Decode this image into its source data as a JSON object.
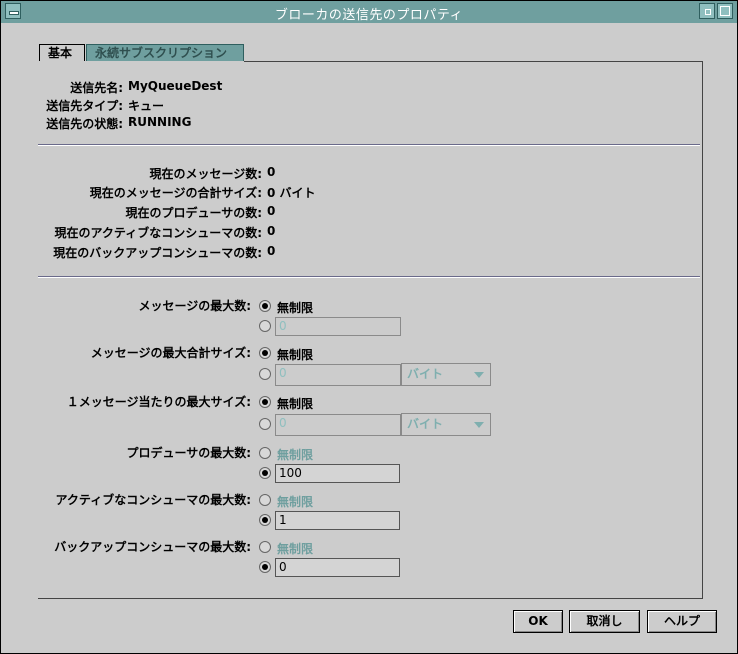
{
  "window": {
    "title": "ブローカの送信先のプロパティ"
  },
  "tabs": [
    {
      "label": "基本",
      "active": true
    },
    {
      "label": "永続サブスクリプション",
      "active": false
    }
  ],
  "info": {
    "name_label": "送信先名:",
    "name_value": "MyQueueDest",
    "type_label": "送信先タイプ:",
    "type_value": "キュー",
    "state_label": "送信先の状態:",
    "state_value": "RUNNING"
  },
  "stats": {
    "cur_msgs_label": "現在のメッセージ数:",
    "cur_msgs_value": "0",
    "cur_total_label": "現在のメッセージの合計サイズ:",
    "cur_total_value": "0 バイト",
    "cur_producers_label": "現在のプロデューサの数:",
    "cur_producers_value": "0",
    "cur_active_label": "現在のアクティブなコンシューマの数:",
    "cur_active_value": "0",
    "cur_backup_label": "現在のバックアップコンシューマの数:",
    "cur_backup_value": "0"
  },
  "limits": {
    "unlimited": "無制限",
    "max_msgs_label": "メッセージの最大数:",
    "max_msgs_value": "0",
    "max_total_label": "メッセージの最大合計サイズ:",
    "max_total_value": "0",
    "max_total_unit": "バイト",
    "max_per_label": "１メッセージ当たりの最大サイズ:",
    "max_per_value": "0",
    "max_per_unit": "バイト",
    "max_producers_label": "プロデューサの最大数:",
    "max_producers_value": "100",
    "max_active_label": "アクティブなコンシューマの最大数:",
    "max_active_value": "1",
    "max_backup_label": "バックアップコンシューマの最大数:",
    "max_backup_value": "0"
  },
  "buttons": {
    "ok": "OK",
    "cancel": "取消し",
    "help": "ヘルプ"
  }
}
